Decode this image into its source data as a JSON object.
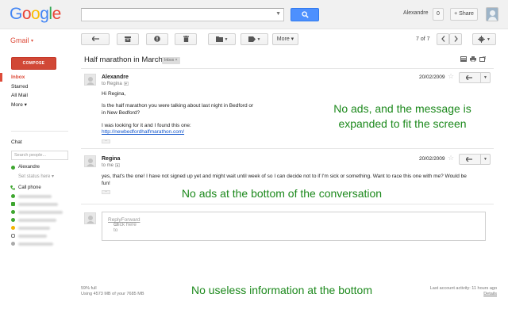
{
  "topbar": {
    "logo_letters": [
      "G",
      "o",
      "o",
      "g",
      "l",
      "e"
    ],
    "logo_colors": [
      "#4285f4",
      "#ea4335",
      "#fbbc05",
      "#4285f4",
      "#34a853",
      "#ea4335"
    ],
    "search_value": "",
    "search_icon": "search-icon",
    "user_name": "Alexandre",
    "notification_count": "0",
    "share_label": "+ Share"
  },
  "toolbar": {
    "gmail_label": "Gmail",
    "gmail_caret": "▾",
    "more_label": "More ▾",
    "pager": "7 of 7",
    "icons": [
      "back-arrow-icon",
      "archive-icon",
      "report-spam-icon",
      "delete-icon",
      "move-to-folder-icon",
      "label-icon",
      "prev-chevron-icon",
      "next-chevron-icon",
      "gear-icon"
    ]
  },
  "sidebar": {
    "compose_label": "COMPOSE",
    "items": [
      {
        "label": "Inbox",
        "active": true
      },
      {
        "label": "Starred",
        "active": false
      },
      {
        "label": "All Mail",
        "active": false
      },
      {
        "label": "More ▾",
        "active": false
      }
    ],
    "chat_label": "Chat",
    "chat_search_placeholder": "Search people...",
    "self_name": "Alexandre",
    "set_status": "Set status here ▾",
    "call_phone": "Call phone"
  },
  "conversation": {
    "subject": "Half marathon in March",
    "label_chip": "Inbox ×",
    "messages": [
      {
        "sender": "Alexandre",
        "to": "to Regina",
        "date": "20/02/2009",
        "greeting": "Hi Regina,",
        "line1": "Is the half marathon you were talking about last night in Bedford or",
        "line2": "in New Bedford?",
        "line3": "I was looking for it and I found this one:",
        "link": "http://newbedfordhalfmarathon.com/"
      },
      {
        "sender": "Regina",
        "to": "to me",
        "date": "20/02/2009",
        "line1": "yes, that's the one!  I have not signed up yet and might wait until week of so I can decide not to if I'm sick or something.  Want to race this one with me? Would be",
        "line2": "fun!"
      }
    ],
    "reply_prefix": "Click here to ",
    "reply_link": "Reply",
    "reply_or": " or ",
    "forward_link": "Forward"
  },
  "footer": {
    "usage_percent": "59% full",
    "usage_text": "Using 4573 MB of your 7685 MB",
    "last_activity": "Last account activity: 11 hours ago",
    "details": "Details"
  },
  "annotations": {
    "top_line1": "No ads, and the message is",
    "top_line2": "expanded to fit the screen",
    "middle": "No ads at the bottom of the conversation",
    "bottom": "No useless information at the bottom"
  }
}
